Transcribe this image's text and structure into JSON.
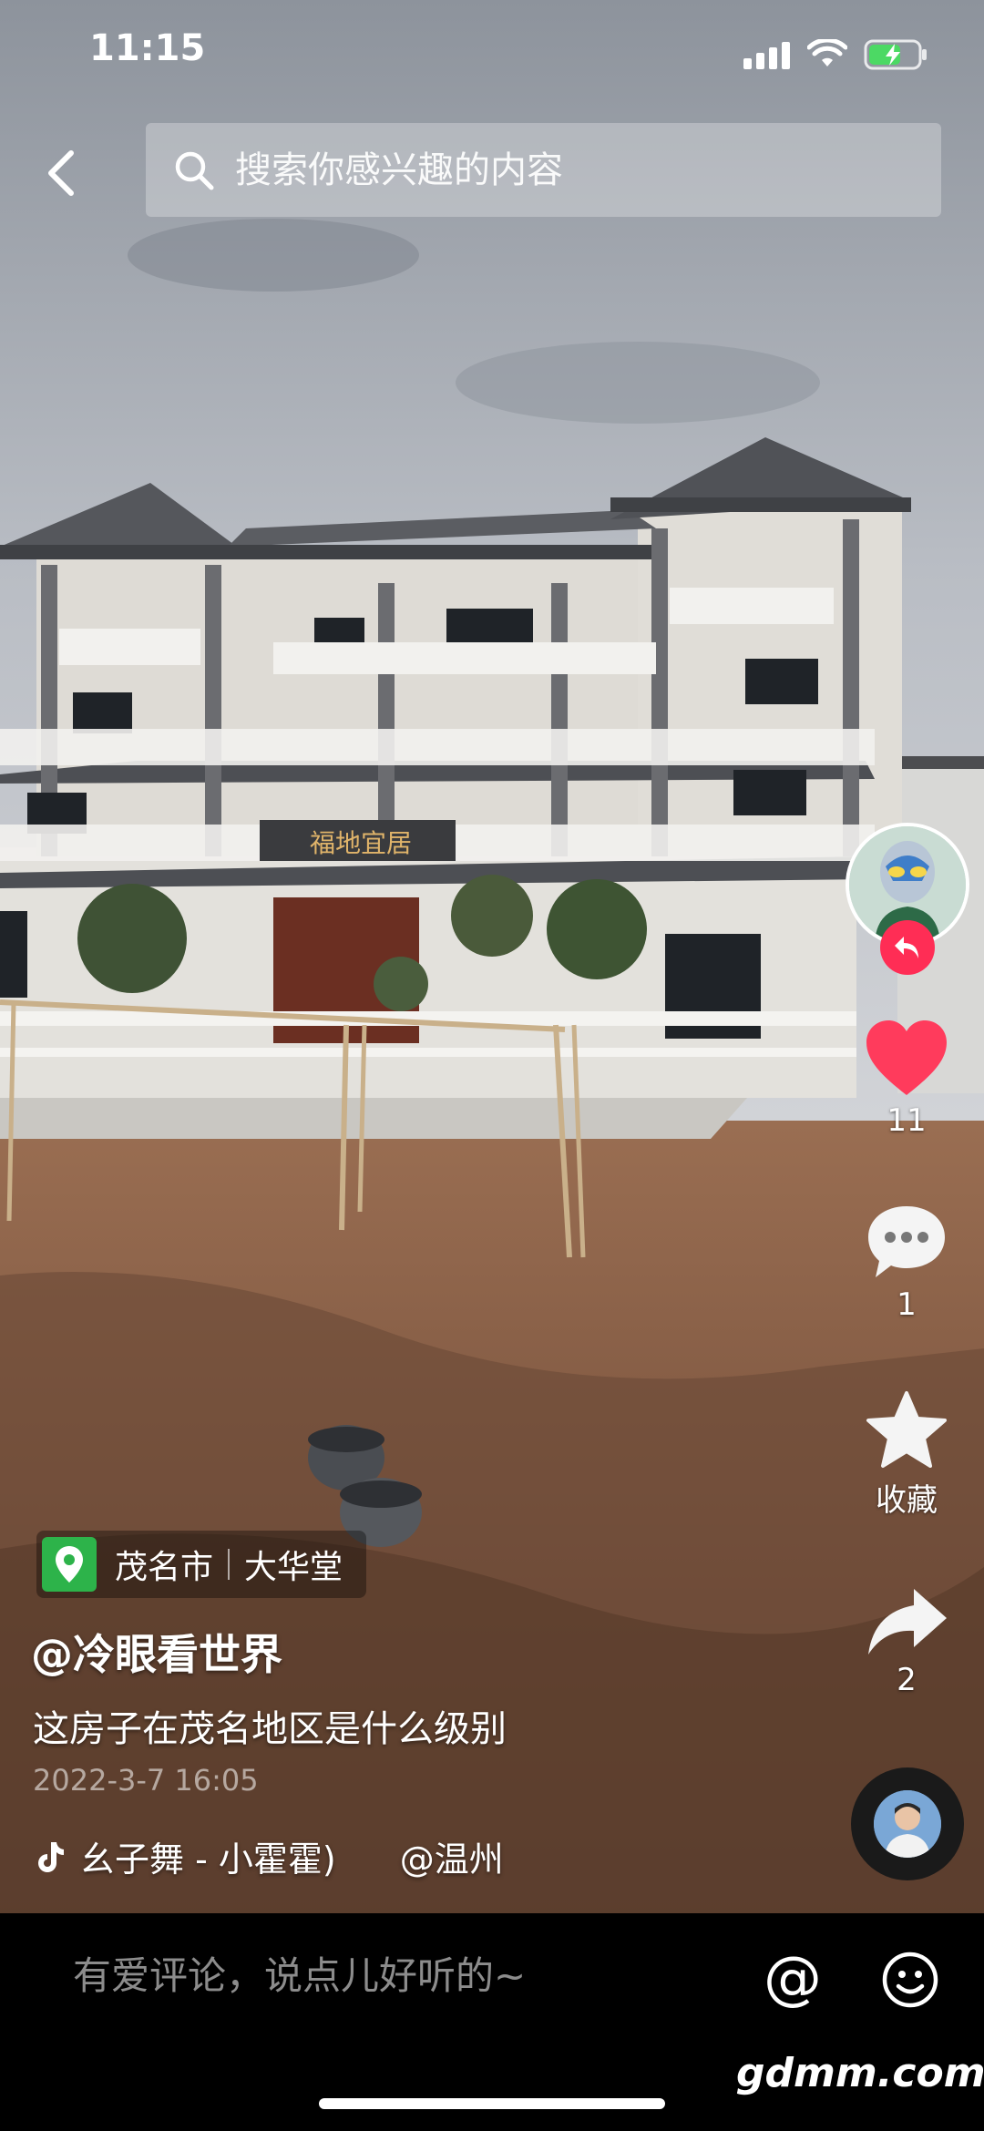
{
  "status_bar": {
    "time": "11:15"
  },
  "search": {
    "placeholder": "搜索你感兴趣的内容"
  },
  "video": {
    "sign_text": "福地宜居"
  },
  "actions": {
    "like_count": "11",
    "comment_count": "1",
    "favorite_label": "收藏",
    "share_count": "2"
  },
  "post": {
    "location_city": "茂名市",
    "location_place": "大华堂",
    "author": "@冷眼看世界",
    "caption": "这房子在茂名地区是什么级别",
    "date": "2022-3-7 16:05",
    "music_title": "幺子舞 - 小霍霍)",
    "music_location": "@温州"
  },
  "comment_bar": {
    "placeholder": "有爱评论，说点儿好听的~",
    "at_symbol": "@"
  },
  "watermark": "gdmm.com",
  "colors": {
    "like": "#ff3b5c",
    "location_pin": "#2db34a",
    "follow_badge": "#ff2d55"
  }
}
